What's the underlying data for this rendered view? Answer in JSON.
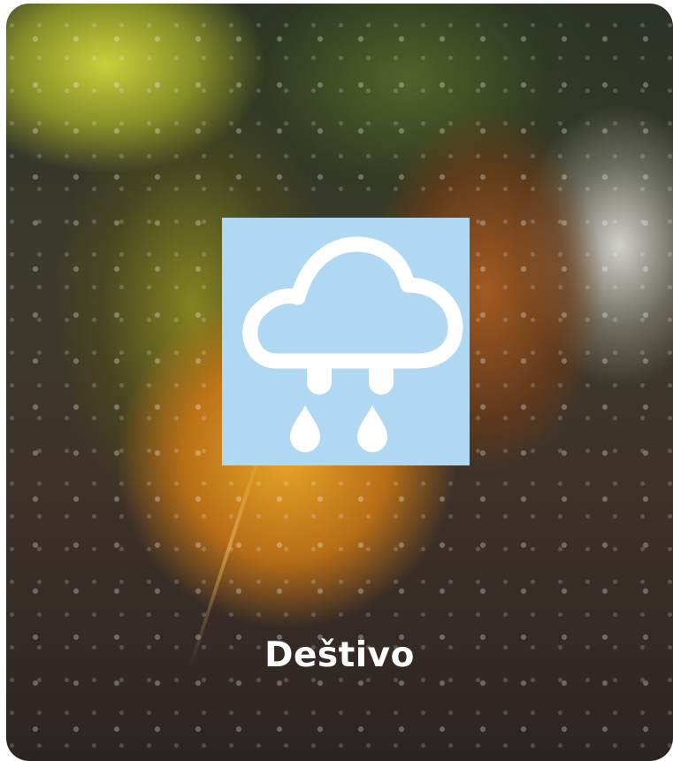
{
  "widget": {
    "label": "Deštivo",
    "icon": "rain-cloud-icon",
    "icon_background": "#b1d8f3",
    "icon_foreground": "#ffffff"
  }
}
